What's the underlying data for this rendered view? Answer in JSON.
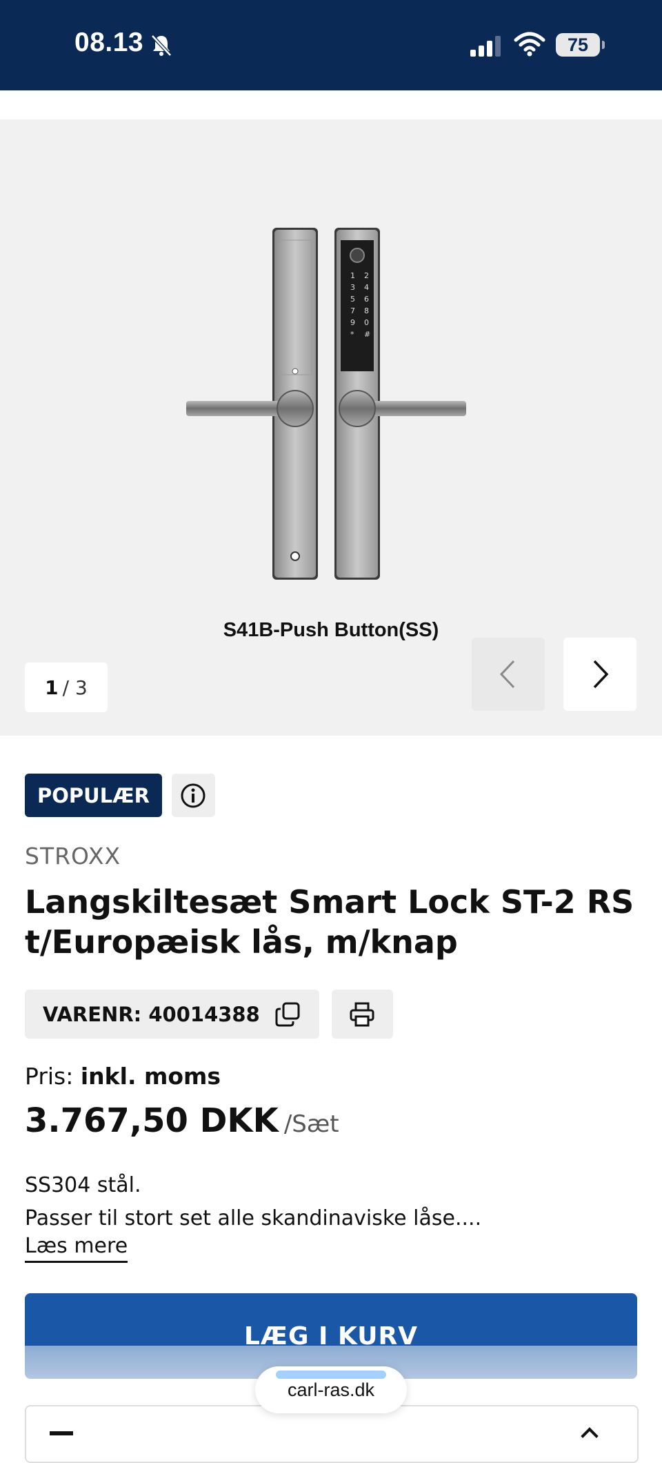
{
  "status_bar": {
    "time": "08.13",
    "battery": "75"
  },
  "gallery": {
    "caption": "S41B-Push Button(SS)",
    "counter_current": "1",
    "counter_total": "/ 3",
    "keypad_keys": [
      "1",
      "2",
      "3",
      "4",
      "5",
      "6",
      "7",
      "8",
      "9",
      "0",
      "*",
      "#"
    ]
  },
  "product": {
    "badge": "POPULÆR",
    "brand": "STROXX",
    "title": "Langskiltesæt Smart Lock ST-2 RS t/Europæisk lås, m/knap",
    "sku_label": "VARENR: 40014388",
    "price_label_prefix": "Pris:",
    "price_label_bold": "inkl. moms",
    "price": "3.767,50 DKK",
    "price_unit": "/Sæt",
    "desc_line1": "SS304 stål.",
    "desc_line2": "Passer til stort set alle skandinaviske låse....",
    "read_more": "Læs mere",
    "add_to_cart": "LÆG I KURV"
  },
  "browser": {
    "url": "carl-ras.dk"
  },
  "colors": {
    "header_bg": "#0a2a55",
    "accent_blue": "#1a58a7",
    "gallery_bg": "#f1f1f1"
  }
}
